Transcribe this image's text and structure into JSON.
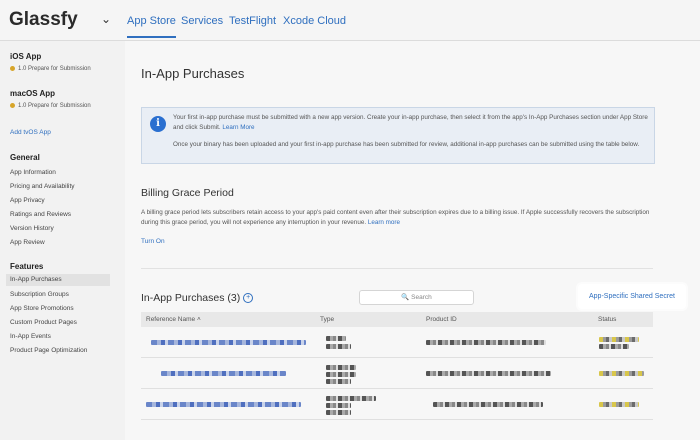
{
  "app": {
    "name": "Glassfy"
  },
  "tabs": [
    {
      "label": "App Store"
    },
    {
      "label": "Services"
    },
    {
      "label": "TestFlight"
    },
    {
      "label": "Xcode Cloud"
    }
  ],
  "sidebar": {
    "ios": {
      "title": "iOS App",
      "version": "1.0 Prepare for Submission"
    },
    "macos": {
      "title": "macOS App",
      "version": "1.0 Prepare for Submission"
    },
    "add_tvos": "Add tvOS App",
    "general": {
      "title": "General",
      "items": [
        "App Information",
        "Pricing and Availability",
        "App Privacy",
        "Ratings and Reviews",
        "Version History",
        "App Review"
      ]
    },
    "features": {
      "title": "Features",
      "items": [
        "In-App Purchases",
        "Subscription Groups",
        "App Store Promotions",
        "Custom Product Pages",
        "In-App Events",
        "Product Page Optimization"
      ]
    }
  },
  "main": {
    "title": "In-App Purchases",
    "info": {
      "line1_text": "Your first in-app purchase must be submitted with a new app version. Create your in-app purchase, then select it from the app's In-App Purchases section under App Store and click Submit. ",
      "line1_link": "Learn More",
      "line2_text": "Once your binary has been uploaded and your first in-app purchase has been submitted for review, additional in-app purchases can be submitted using the table below."
    },
    "grace": {
      "title": "Billing Grace Period",
      "desc": "A billing grace period lets subscribers retain access to your app's paid content even after their subscription expires due to a billing issue. If Apple successfully recovers the subscription during this grace period, you will not experience any interruption in your revenue. ",
      "desc_link": "Learn more",
      "action": "Turn On"
    },
    "iap": {
      "title": "In-App Purchases (3)",
      "search_placeholder": "Search",
      "shared_secret": "App-Specific Shared Secret",
      "columns": [
        "Reference Name",
        "Type",
        "Product ID",
        "Status"
      ]
    }
  }
}
